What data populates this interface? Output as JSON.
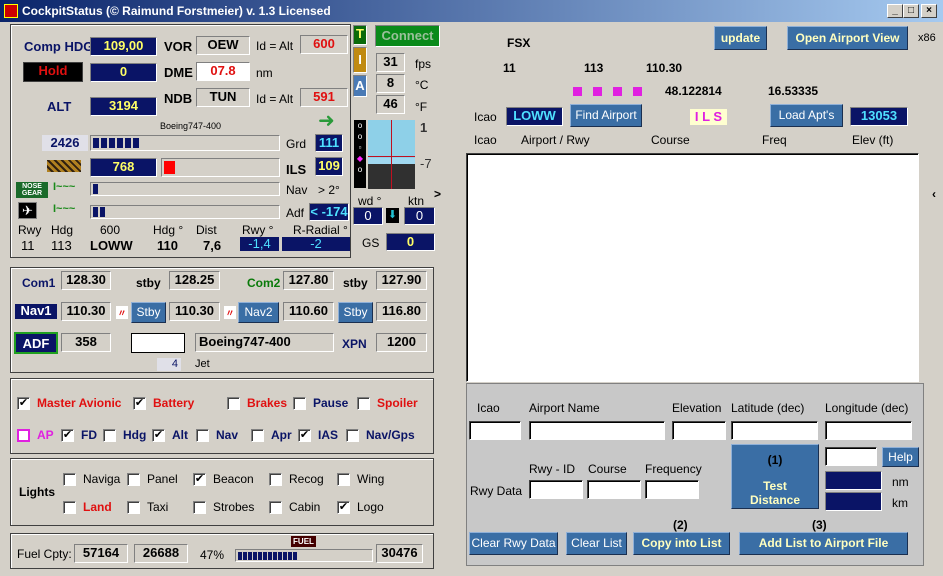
{
  "window": {
    "title": "CockpitStatus (© Raimund Forstmeier) v. 1.3 Licensed",
    "min": "_",
    "max": "□",
    "close": "×"
  },
  "instruments": {
    "comp_hdg_label": "Comp HDG",
    "comp_hdg": "109,00",
    "vor_label": "VOR",
    "vor": "OEW",
    "id_alt_1": "Id = Alt",
    "vor_alt": "600",
    "hold_label": "Hold",
    "hold": "0",
    "dme_label": "DME",
    "dme": "07.8",
    "nm": "nm",
    "alt_label": "ALT",
    "alt": "3194",
    "ndb_label": "NDB",
    "ndb": "TUN",
    "id_alt_2": "Id = Alt",
    "ndb_alt": "591",
    "aircraft": "Boeing747-400",
    "ground_alt": "2426",
    "grd_label": "Grd",
    "grd": "111",
    "grd_bar_blocks": 6,
    "vs": "768",
    "ils_label": "ILS",
    "ils": "109",
    "nav_label": "Nav",
    "nav_limit": "> 2°",
    "adf_label": "Adf",
    "adf": "< -174",
    "nose_gear": "NOSE GEAR",
    "gear_sym_1": "I~~~",
    "gear_sym_2": "I~~~",
    "bottom_headers": [
      "Rwy",
      "Hdg",
      "600",
      "Hdg °",
      "Dist",
      "Rwy °",
      "R-Radial °"
    ],
    "bottom_values": [
      "11",
      "113",
      "LOWW",
      "110",
      "7,6",
      "-1,4",
      "-2"
    ]
  },
  "side": {
    "t": "T",
    "i": "I",
    "a": "A",
    "connect": "Connect",
    "fps": "31",
    "fps_label": "fps",
    "temp_c": "8",
    "c_label": "°C",
    "temp_f": "46",
    "f_label": "°F",
    "ils_top": "1",
    "ils_bottom": "-7",
    "expand": ">",
    "wd_label": "wd °",
    "ktn_label": "ktn",
    "wd": "0",
    "ktn": "0",
    "gs_label": "GS",
    "gs": "0"
  },
  "radios": {
    "com1_label": "Com1",
    "com1": "128.30",
    "stby1_label": "stby",
    "com1_stby": "128.25",
    "com2_label": "Com2",
    "com2": "127.80",
    "stby2_label": "stby",
    "com2_stby": "127.90",
    "nav1_label": "Nav1",
    "nav1": "110.30",
    "nav1_stby_btn": "Stby",
    "nav1_stby": "110.30",
    "nav2_btn": "Nav2",
    "nav2": "110.60",
    "nav2_stby_btn": "Stby",
    "nav2_stby": "116.80",
    "adf_btn": "ADF",
    "adf": "358",
    "input": "",
    "aircraft": "Boeing747-400",
    "xpn_label": "XPN",
    "xpn": "1200",
    "engines": "4",
    "engine_type": "Jet"
  },
  "switches": {
    "row1": [
      {
        "label": "Master Avionic",
        "checked": true,
        "color": "#e01010"
      },
      {
        "label": "Battery",
        "checked": true,
        "color": "#e01010"
      },
      {
        "label": "Brakes",
        "checked": false,
        "color": "#e01010"
      },
      {
        "label": "Pause",
        "checked": false,
        "color": "#0a1466"
      },
      {
        "label": "Spoiler",
        "checked": false,
        "color": "#e01010"
      }
    ],
    "row2": [
      {
        "label": "AP",
        "checked": false,
        "color": "#e020e0"
      },
      {
        "label": "FD",
        "checked": true,
        "color": "#0a1466"
      },
      {
        "label": "Hdg",
        "checked": false,
        "color": "#0a1466"
      },
      {
        "label": "Alt",
        "checked": true,
        "color": "#0a1466"
      },
      {
        "label": "Nav",
        "checked": false,
        "color": "#0a1466"
      },
      {
        "label": "Apr",
        "checked": false,
        "color": "#0a1466"
      },
      {
        "label": "IAS",
        "checked": true,
        "color": "#0a1466"
      },
      {
        "label": "Nav/Gps",
        "checked": false,
        "color": "#0a1466"
      }
    ]
  },
  "lights": {
    "title": "Lights",
    "row1": [
      {
        "label": "Naviga",
        "checked": false
      },
      {
        "label": "Panel",
        "checked": false
      },
      {
        "label": "Beacon",
        "checked": true
      },
      {
        "label": "Recog",
        "checked": false
      },
      {
        "label": "Wing",
        "checked": false
      }
    ],
    "row2": [
      {
        "label": "Land",
        "checked": false
      },
      {
        "label": "Taxi",
        "checked": false
      },
      {
        "label": "Strobes",
        "checked": false
      },
      {
        "label": "Cabin",
        "checked": false
      },
      {
        "label": "Logo",
        "checked": true
      }
    ]
  },
  "fuel": {
    "label": "Fuel Cpty:",
    "capacity": "57164",
    "current": "26688",
    "percent": "47%",
    "percent_value": 47,
    "icon": "FUEL",
    "remaining": "30476"
  },
  "airport": {
    "sim": "FSX",
    "update": "update",
    "open_view": "Open Airport View",
    "arch": "x86",
    "rwy": "11",
    "hdg": "113",
    "freq": "110.30",
    "lat": "48.122814",
    "lon": "16.53335",
    "icao_label": "Icao",
    "icao": "LOWW",
    "find": "Find Airport",
    "ils": "I L S",
    "load": "Load Apt's",
    "count": "13053",
    "columns": [
      "Icao",
      "Airport / Rwy",
      "Course",
      "Freq",
      "Elev (ft)"
    ],
    "rows": []
  },
  "editor": {
    "labels": [
      "Icao",
      "Airport Name",
      "Elevation",
      "Latitude (dec)",
      "Longitude (dec)"
    ],
    "rwy_data": "Rwy Data",
    "rwy_labels": [
      "Rwy -  ID",
      "Course",
      "Frequency"
    ],
    "test_num": "(1)",
    "test": "Test Distance",
    "help": "Help",
    "nm": "nm",
    "km": "km",
    "step2": "(2)",
    "step3": "(3)",
    "clear_rwy": "Clear Rwy Data",
    "clear_list": "Clear List",
    "copy": "Copy into List",
    "add": "Add List to Airport File"
  },
  "colors": {
    "navy": "#0a1466",
    "accent_blue": "#3a6ea5",
    "red": "#e01010",
    "magenta": "#e020e0",
    "green": "#0a7a0a"
  }
}
